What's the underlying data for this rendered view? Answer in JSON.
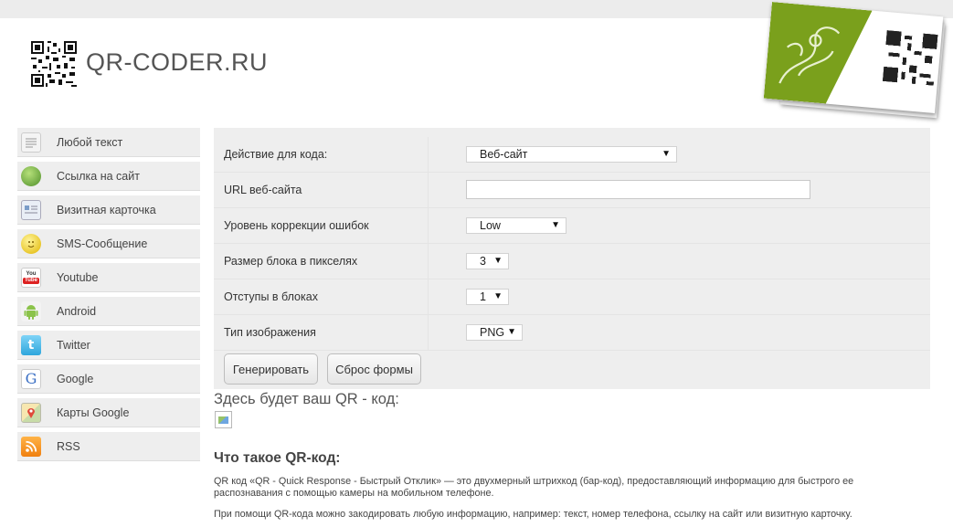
{
  "header": {
    "site_title": "QR-CODER.RU"
  },
  "sidebar": {
    "items": [
      {
        "label": "Любой текст",
        "icon": "text-document-icon"
      },
      {
        "label": "Ссылка на сайт",
        "icon": "globe-link-icon"
      },
      {
        "label": "Визитная карточка",
        "icon": "business-card-icon"
      },
      {
        "label": "SMS-Сообщение",
        "icon": "smiley-sms-icon"
      },
      {
        "label": "Youtube",
        "icon": "youtube-icon"
      },
      {
        "label": "Android",
        "icon": "android-icon"
      },
      {
        "label": "Twitter",
        "icon": "twitter-icon"
      },
      {
        "label": "Google",
        "icon": "google-icon"
      },
      {
        "label": "Карты Google",
        "icon": "google-maps-icon"
      },
      {
        "label": "RSS",
        "icon": "rss-icon"
      }
    ]
  },
  "form": {
    "action_label": "Действие для кода:",
    "action_value": "Веб-сайт",
    "url_label": "URL веб-сайта",
    "url_value": "",
    "error_label": "Уровень коррекции ошибок",
    "error_value": "Low",
    "block_size_label": "Размер блока в пикселях",
    "block_size_value": "3",
    "padding_label": "Отступы в блоках",
    "padding_value": "1",
    "image_type_label": "Тип изображения",
    "image_type_value": "PNG",
    "generate_button": "Генерировать",
    "reset_button": "Сброс формы"
  },
  "result": {
    "heading": "Здесь будет ваш QR - код:"
  },
  "about": {
    "heading": "Что такое QR-код:",
    "paragraph1_line1": "QR код «QR - Quick Response - Быстрый Отклик» — это двухмерный штрихкод (бар-код), предоставляющий информацию для быстрого ее",
    "paragraph1_line2": "распознавания с помощью камеры на мобильном телефоне.",
    "paragraph2": "При помощи QR-кода можно закодировать любую информацию, например: текст, номер телефона, ссылку на сайт или визитную карточку."
  },
  "colors": {
    "accent_green": "#7aa01c",
    "panel_bg": "#eeeeee"
  }
}
